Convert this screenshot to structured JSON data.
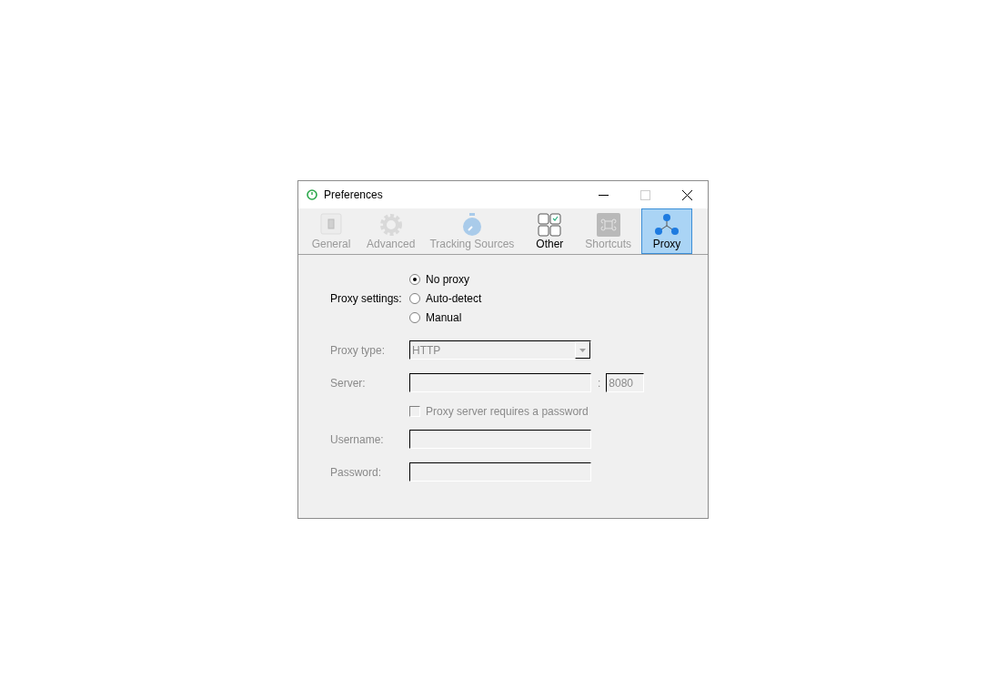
{
  "window": {
    "title": "Preferences"
  },
  "tabs": [
    {
      "label": "General",
      "kind": "switch",
      "selected": false,
      "disabled": true
    },
    {
      "label": "Advanced",
      "kind": "gear",
      "selected": false,
      "disabled": true
    },
    {
      "label": "Tracking Sources",
      "kind": "stopwatch",
      "selected": false,
      "disabled": true
    },
    {
      "label": "Other",
      "kind": "checkboxes",
      "selected": false,
      "disabled": false
    },
    {
      "label": "Shortcuts",
      "kind": "command",
      "selected": false,
      "disabled": true
    },
    {
      "label": "Proxy",
      "kind": "network",
      "selected": true,
      "disabled": false
    }
  ],
  "proxy_settings": {
    "label": "Proxy settings:",
    "options": [
      {
        "label": "No proxy",
        "selected": true
      },
      {
        "label": "Auto-detect",
        "selected": false
      },
      {
        "label": "Manual",
        "selected": false
      }
    ]
  },
  "form": [
    {
      "kind": "select",
      "label": "Proxy type:",
      "value": "HTTP",
      "disabled": true
    },
    {
      "kind": "server",
      "label": "Server:",
      "separator": ":",
      "port": "8080",
      "disabled": true
    },
    {
      "kind": "checkbox",
      "label": "Proxy server requires a password",
      "checked": false,
      "disabled": true
    },
    {
      "kind": "text",
      "label": "Username:",
      "disabled": true
    },
    {
      "kind": "text",
      "label": "Password:",
      "disabled": true
    }
  ]
}
